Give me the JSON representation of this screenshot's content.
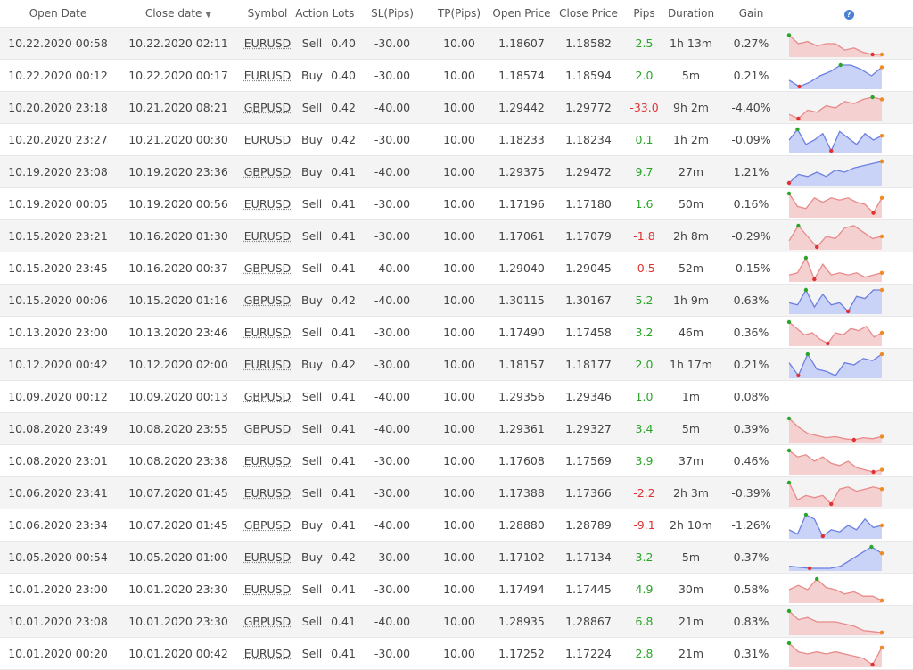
{
  "header": {
    "open_date": "Open Date",
    "close_date": "Close date",
    "symbol": "Symbol",
    "action": "Action",
    "lots": "Lots",
    "sl": "SL(Pips)",
    "tp": "TP(Pips)",
    "open_price": "Open Price",
    "close_price": "Close Price",
    "pips": "Pips",
    "duration": "Duration",
    "gain": "Gain",
    "help_icon": "?",
    "sort_icon": "caret-down-icon"
  },
  "colors": {
    "positive": "#2aa52a",
    "negative": "#e03131",
    "buy_line": "#6c7fe0",
    "buy_fill": "#c9d3f7",
    "sell_line": "#e88a8a",
    "sell_fill": "#f5d0d0",
    "marker_max": "#2aa52a",
    "marker_min": "#e03131",
    "marker_end": "#f08a24"
  },
  "trades": [
    {
      "open": "10.22.2020 00:58",
      "close": "10.22.2020 02:11",
      "symbol": "EURUSD",
      "action": "Sell",
      "lots": "0.40",
      "sl": "-30.00",
      "tp": "10.00",
      "open_price": "1.18607",
      "close_price": "1.18582",
      "pips": "2.5",
      "duration": "1h 13m",
      "gain": "0.27%",
      "spark": [
        9,
        5,
        6,
        4,
        5,
        5,
        2,
        3,
        1,
        0,
        0
      ]
    },
    {
      "open": "10.22.2020 00:12",
      "close": "10.22.2020 00:17",
      "symbol": "EURUSD",
      "action": "Buy",
      "lots": "0.40",
      "sl": "-30.00",
      "tp": "10.00",
      "open_price": "1.18574",
      "close_price": "1.18594",
      "pips": "2.0",
      "duration": "5m",
      "gain": "0.21%",
      "spark": [
        3,
        0,
        2,
        5,
        7,
        10,
        10,
        8,
        5,
        9
      ]
    },
    {
      "open": "10.20.2020 23:18",
      "close": "10.21.2020 08:21",
      "symbol": "GBPUSD",
      "action": "Sell",
      "lots": "0.42",
      "sl": "-40.00",
      "tp": "10.00",
      "open_price": "1.29442",
      "close_price": "1.29772",
      "pips": "-33.0",
      "duration": "9h 2m",
      "gain": "-4.40%",
      "spark": [
        2,
        0,
        4,
        3,
        6,
        5,
        8,
        7,
        9,
        10,
        9
      ]
    },
    {
      "open": "10.20.2020 23:27",
      "close": "10.21.2020 00:30",
      "symbol": "EURUSD",
      "action": "Buy",
      "lots": "0.42",
      "sl": "-30.00",
      "tp": "10.00",
      "open_price": "1.18233",
      "close_price": "1.18234",
      "pips": "0.1",
      "duration": "1h 2m",
      "gain": "-0.09%",
      "spark": [
        5,
        10,
        3,
        5,
        8,
        0,
        9,
        6,
        3,
        8,
        5,
        7
      ]
    },
    {
      "open": "10.19.2020 23:08",
      "close": "10.19.2020 23:36",
      "symbol": "GBPUSD",
      "action": "Buy",
      "lots": "0.41",
      "sl": "-40.00",
      "tp": "10.00",
      "open_price": "1.29375",
      "close_price": "1.29472",
      "pips": "9.7",
      "duration": "27m",
      "gain": "1.21%",
      "spark": [
        0,
        4,
        3,
        5,
        3,
        6,
        5,
        7,
        8,
        9,
        10
      ]
    },
    {
      "open": "10.19.2020 00:05",
      "close": "10.19.2020 00:56",
      "symbol": "EURUSD",
      "action": "Sell",
      "lots": "0.41",
      "sl": "-30.00",
      "tp": "10.00",
      "open_price": "1.17196",
      "close_price": "1.17180",
      "pips": "1.6",
      "duration": "50m",
      "gain": "0.16%",
      "spark": [
        10,
        4,
        3,
        8,
        6,
        8,
        7,
        8,
        6,
        5,
        1,
        8
      ]
    },
    {
      "open": "10.15.2020 23:21",
      "close": "10.16.2020 01:30",
      "symbol": "EURUSD",
      "action": "Sell",
      "lots": "0.41",
      "sl": "-30.00",
      "tp": "10.00",
      "open_price": "1.17061",
      "close_price": "1.17079",
      "pips": "-1.8",
      "duration": "2h 8m",
      "gain": "-0.29%",
      "spark": [
        3,
        10,
        5,
        0,
        5,
        4,
        9,
        10,
        7,
        4,
        5
      ]
    },
    {
      "open": "10.15.2020 23:45",
      "close": "10.16.2020 00:37",
      "symbol": "GBPUSD",
      "action": "Sell",
      "lots": "0.41",
      "sl": "-40.00",
      "tp": "10.00",
      "open_price": "1.29040",
      "close_price": "1.29045",
      "pips": "-0.5",
      "duration": "52m",
      "gain": "-0.15%",
      "spark": [
        2,
        3,
        10,
        0,
        7,
        2,
        3,
        2,
        3,
        1,
        2,
        3
      ]
    },
    {
      "open": "10.15.2020 00:06",
      "close": "10.15.2020 01:16",
      "symbol": "GBPUSD",
      "action": "Buy",
      "lots": "0.42",
      "sl": "-40.00",
      "tp": "10.00",
      "open_price": "1.30115",
      "close_price": "1.30167",
      "pips": "5.2",
      "duration": "1h 9m",
      "gain": "0.63%",
      "spark": [
        4,
        3,
        10,
        2,
        8,
        3,
        4,
        0,
        7,
        6,
        10,
        10
      ]
    },
    {
      "open": "10.13.2020 23:00",
      "close": "10.13.2020 23:46",
      "symbol": "EURUSD",
      "action": "Sell",
      "lots": "0.41",
      "sl": "-30.00",
      "tp": "10.00",
      "open_price": "1.17490",
      "close_price": "1.17458",
      "pips": "3.2",
      "duration": "46m",
      "gain": "0.36%",
      "spark": [
        10,
        7,
        4,
        5,
        2,
        0,
        5,
        4,
        7,
        6,
        8,
        3,
        5
      ]
    },
    {
      "open": "10.12.2020 00:42",
      "close": "10.12.2020 02:00",
      "symbol": "EURUSD",
      "action": "Buy",
      "lots": "0.42",
      "sl": "-30.00",
      "tp": "10.00",
      "open_price": "1.18157",
      "close_price": "1.18177",
      "pips": "2.0",
      "duration": "1h 17m",
      "gain": "0.21%",
      "spark": [
        6,
        0,
        10,
        3,
        2,
        0,
        6,
        5,
        8,
        7,
        10
      ]
    },
    {
      "open": "10.09.2020 00:12",
      "close": "10.09.2020 00:13",
      "symbol": "GBPUSD",
      "action": "Sell",
      "lots": "0.41",
      "sl": "-40.00",
      "tp": "10.00",
      "open_price": "1.29356",
      "close_price": "1.29346",
      "pips": "1.0",
      "duration": "1m",
      "gain": "0.08%",
      "spark": []
    },
    {
      "open": "10.08.2020 23:49",
      "close": "10.08.2020 23:55",
      "symbol": "GBPUSD",
      "action": "Sell",
      "lots": "0.41",
      "sl": "-40.00",
      "tp": "10.00",
      "open_price": "1.29361",
      "close_price": "1.29327",
      "pips": "3.4",
      "duration": "5m",
      "gain": "0.39%",
      "spark": [
        10,
        6,
        3,
        2,
        1,
        1.5,
        0.5,
        0,
        1,
        0.5,
        1.5
      ]
    },
    {
      "open": "10.08.2020 23:01",
      "close": "10.08.2020 23:38",
      "symbol": "EURUSD",
      "action": "Sell",
      "lots": "0.41",
      "sl": "-30.00",
      "tp": "10.00",
      "open_price": "1.17608",
      "close_price": "1.17569",
      "pips": "3.9",
      "duration": "37m",
      "gain": "0.46%",
      "spark": [
        10,
        7,
        8,
        5,
        7,
        4,
        3,
        5,
        2,
        1,
        0,
        1
      ]
    },
    {
      "open": "10.06.2020 23:41",
      "close": "10.07.2020 01:45",
      "symbol": "EURUSD",
      "action": "Sell",
      "lots": "0.41",
      "sl": "-30.00",
      "tp": "10.00",
      "open_price": "1.17388",
      "close_price": "1.17366",
      "pips": "-2.2",
      "duration": "2h 3m",
      "gain": "-0.39%",
      "spark": [
        10,
        2,
        4,
        3,
        4,
        0,
        7,
        8,
        6,
        7,
        8,
        7
      ]
    },
    {
      "open": "10.06.2020 23:34",
      "close": "10.07.2020 01:45",
      "symbol": "GBPUSD",
      "action": "Buy",
      "lots": "0.41",
      "sl": "-40.00",
      "tp": "10.00",
      "open_price": "1.28880",
      "close_price": "1.28789",
      "pips": "-9.1",
      "duration": "2h 10m",
      "gain": "-1.26%",
      "spark": [
        3,
        1,
        10,
        8,
        0,
        3,
        2,
        5,
        3,
        8,
        4,
        5
      ]
    },
    {
      "open": "10.05.2020 00:54",
      "close": "10.05.2020 01:00",
      "symbol": "EURUSD",
      "action": "Buy",
      "lots": "0.42",
      "sl": "-30.00",
      "tp": "10.00",
      "open_price": "1.17102",
      "close_price": "1.17134",
      "pips": "3.2",
      "duration": "5m",
      "gain": "0.37%",
      "spark": [
        1,
        0.5,
        0,
        0,
        0,
        1,
        4,
        7,
        10,
        7
      ]
    },
    {
      "open": "10.01.2020 23:00",
      "close": "10.01.2020 23:30",
      "symbol": "EURUSD",
      "action": "Sell",
      "lots": "0.41",
      "sl": "-30.00",
      "tp": "10.00",
      "open_price": "1.17494",
      "close_price": "1.17445",
      "pips": "4.9",
      "duration": "30m",
      "gain": "0.58%",
      "spark": [
        5,
        7,
        5,
        10,
        6,
        5,
        3,
        4,
        2,
        2,
        0
      ]
    },
    {
      "open": "10.01.2020 23:08",
      "close": "10.01.2020 23:30",
      "symbol": "GBPUSD",
      "action": "Sell",
      "lots": "0.41",
      "sl": "-40.00",
      "tp": "10.00",
      "open_price": "1.28935",
      "close_price": "1.28867",
      "pips": "6.8",
      "duration": "21m",
      "gain": "0.83%",
      "spark": [
        10,
        6,
        7,
        5,
        5,
        5,
        4,
        3,
        1,
        0.5,
        0
      ]
    },
    {
      "open": "10.01.2020 00:20",
      "close": "10.01.2020 00:42",
      "symbol": "EURUSD",
      "action": "Sell",
      "lots": "0.41",
      "sl": "-30.00",
      "tp": "10.00",
      "open_price": "1.17252",
      "close_price": "1.17224",
      "pips": "2.8",
      "duration": "21m",
      "gain": "0.31%",
      "spark": [
        10,
        6,
        5,
        6,
        5,
        6,
        5,
        4,
        3,
        0,
        8
      ]
    }
  ]
}
